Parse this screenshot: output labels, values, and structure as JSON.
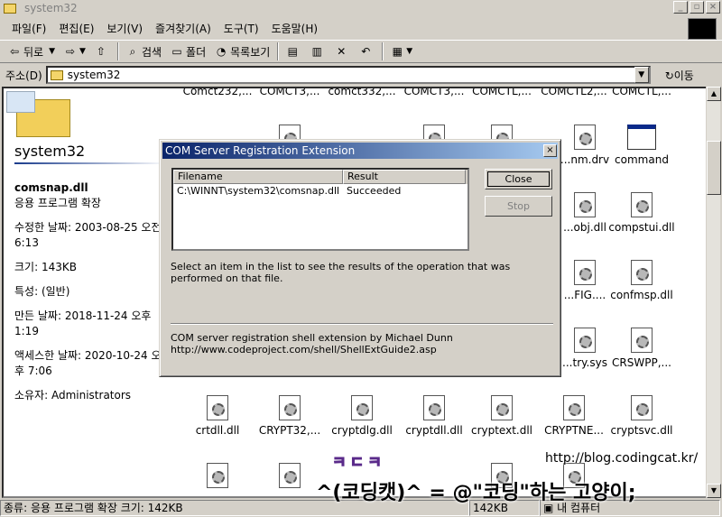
{
  "window": {
    "title": "system32"
  },
  "menu": [
    "파일(F)",
    "편집(E)",
    "보기(V)",
    "즐겨찾기(A)",
    "도구(T)",
    "도움말(H)"
  ],
  "toolbar": {
    "back": "뒤로",
    "search": "검색",
    "folders": "폴더",
    "history": "목록보기"
  },
  "address": {
    "label": "주소(D)",
    "value": "system32",
    "go": "이동"
  },
  "left_pane": {
    "folder_name": "system32",
    "file_name": "comsnap.dll",
    "file_type": "응용 프로그램 확장",
    "modified": "수정한 날짜: 2003-08-25 오전 6:13",
    "size": "크기: 143KB",
    "attributes": "특성: (일반)",
    "created": "만든 날짜: 2018-11-24 오후 1:19",
    "accessed": "액세스한 날짜: 2020-10-24 오후 7:06",
    "owner": "소유자: Administrators"
  },
  "top_row": [
    "Comct232,...",
    "COMCT3,...",
    "comct332,...",
    "COMCT3,...",
    "COMCTL,...",
    "COMCTL2,...",
    "COMCTL,..."
  ],
  "icons": {
    "cmm_drv": "...nm.drv",
    "command": "command",
    "comobj": "...obj.dll",
    "compstui": "compstui.dll",
    "config": "...FIG....",
    "confmsp": "confmsp.dll",
    "ctry": "...try.sys",
    "crswpp": "CRSWPP,...",
    "crtdll": "crtdll.dll",
    "crypt32": "CRYPT32,...",
    "cryptdlg": "cryptdlg.dll",
    "cryptdll": "cryptdll.dll",
    "cryptext": "cryptext.dll",
    "cryptne": "CRYPTNE...",
    "cryptsvc": "cryptsvc.dll"
  },
  "dialog": {
    "title": "COM Server Registration Extension",
    "col_filename": "Filename",
    "col_result": "Result",
    "row_filename": "C:\\WINNT\\system32\\comsnap.dll",
    "row_result": "Succeeded",
    "close": "Close",
    "stop": "Stop",
    "info": "Select an item in the list to see the results of the operation that was performed on that file.",
    "credit_line1": "COM server registration shell extension by Michael Dunn",
    "credit_line2": "http://www.codeproject.com/shell/ShellExtGuide2.asp"
  },
  "status": {
    "text": "종류: 응용 프로그램 확장 크기: 142KB",
    "size": "142KB",
    "zone": "내 컴퓨터"
  },
  "watermark": {
    "url": "http://blog.codingcat.kr/",
    "logo": "ㅋㄷㅋ",
    "line": "^(코딩캣)^ = @\"코딩\"하는 고양이;"
  }
}
